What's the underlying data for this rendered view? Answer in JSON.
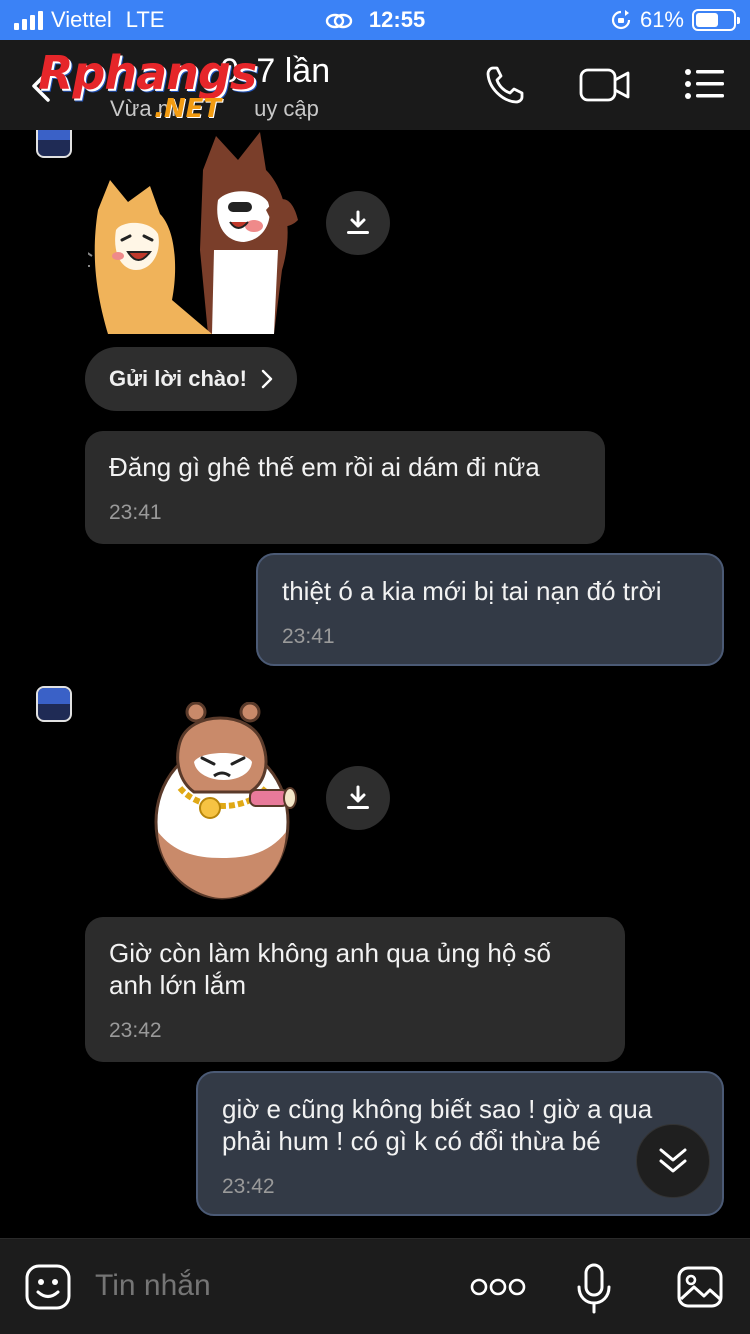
{
  "status_bar": {
    "carrier": "Viettel",
    "network": "LTE",
    "time": "12:55",
    "battery_percent": "61%",
    "battery_level": 0.61,
    "signal_bars": 4
  },
  "header": {
    "title_visible": "7 lần",
    "title_prefix_partial": "0",
    "subtitle_start": "Vừa m",
    "subtitle_end": "uy cập",
    "watermark_main": "Rphangs",
    "watermark_suffix": ".NET",
    "icons": [
      "back-chevron-icon",
      "phone-icon",
      "video-call-icon",
      "menu-icon"
    ]
  },
  "messages": [
    {
      "type": "sticker",
      "direction": "incoming",
      "sticker": "two-dogs-laughing"
    },
    {
      "type": "action_chip",
      "label": "Gửi lời chào!"
    },
    {
      "type": "text",
      "direction": "incoming",
      "text": "Đăng gì ghê thế em rồi ai dám đi nữa",
      "time": "23:41"
    },
    {
      "type": "text",
      "direction": "outgoing",
      "text": "thiệt ó a kia mới bị tai nạn đó trời",
      "time": "23:41"
    },
    {
      "type": "sticker",
      "direction": "incoming",
      "sticker": "hamster-with-gold-chain"
    },
    {
      "type": "text",
      "direction": "incoming",
      "text": "Giờ còn làm không anh qua ủng hộ số anh lớn lắm",
      "time": "23:42"
    },
    {
      "type": "text",
      "direction": "outgoing",
      "text": "giờ e cũng không biết sao ! giờ a qua phải hum ! có gì k có đổi thừa bé",
      "time": "23:42"
    }
  ],
  "composer": {
    "placeholder": "Tin nhắn",
    "icons": [
      "emoji-icon",
      "more-dots-icon",
      "microphone-icon",
      "image-icon"
    ]
  },
  "colors": {
    "status_bar": "#3b82f6",
    "header": "#1a1a1a",
    "incoming_bubble": "#2c2c2c",
    "outgoing_bubble": "#333a46",
    "outgoing_border": "#4b5a75"
  }
}
